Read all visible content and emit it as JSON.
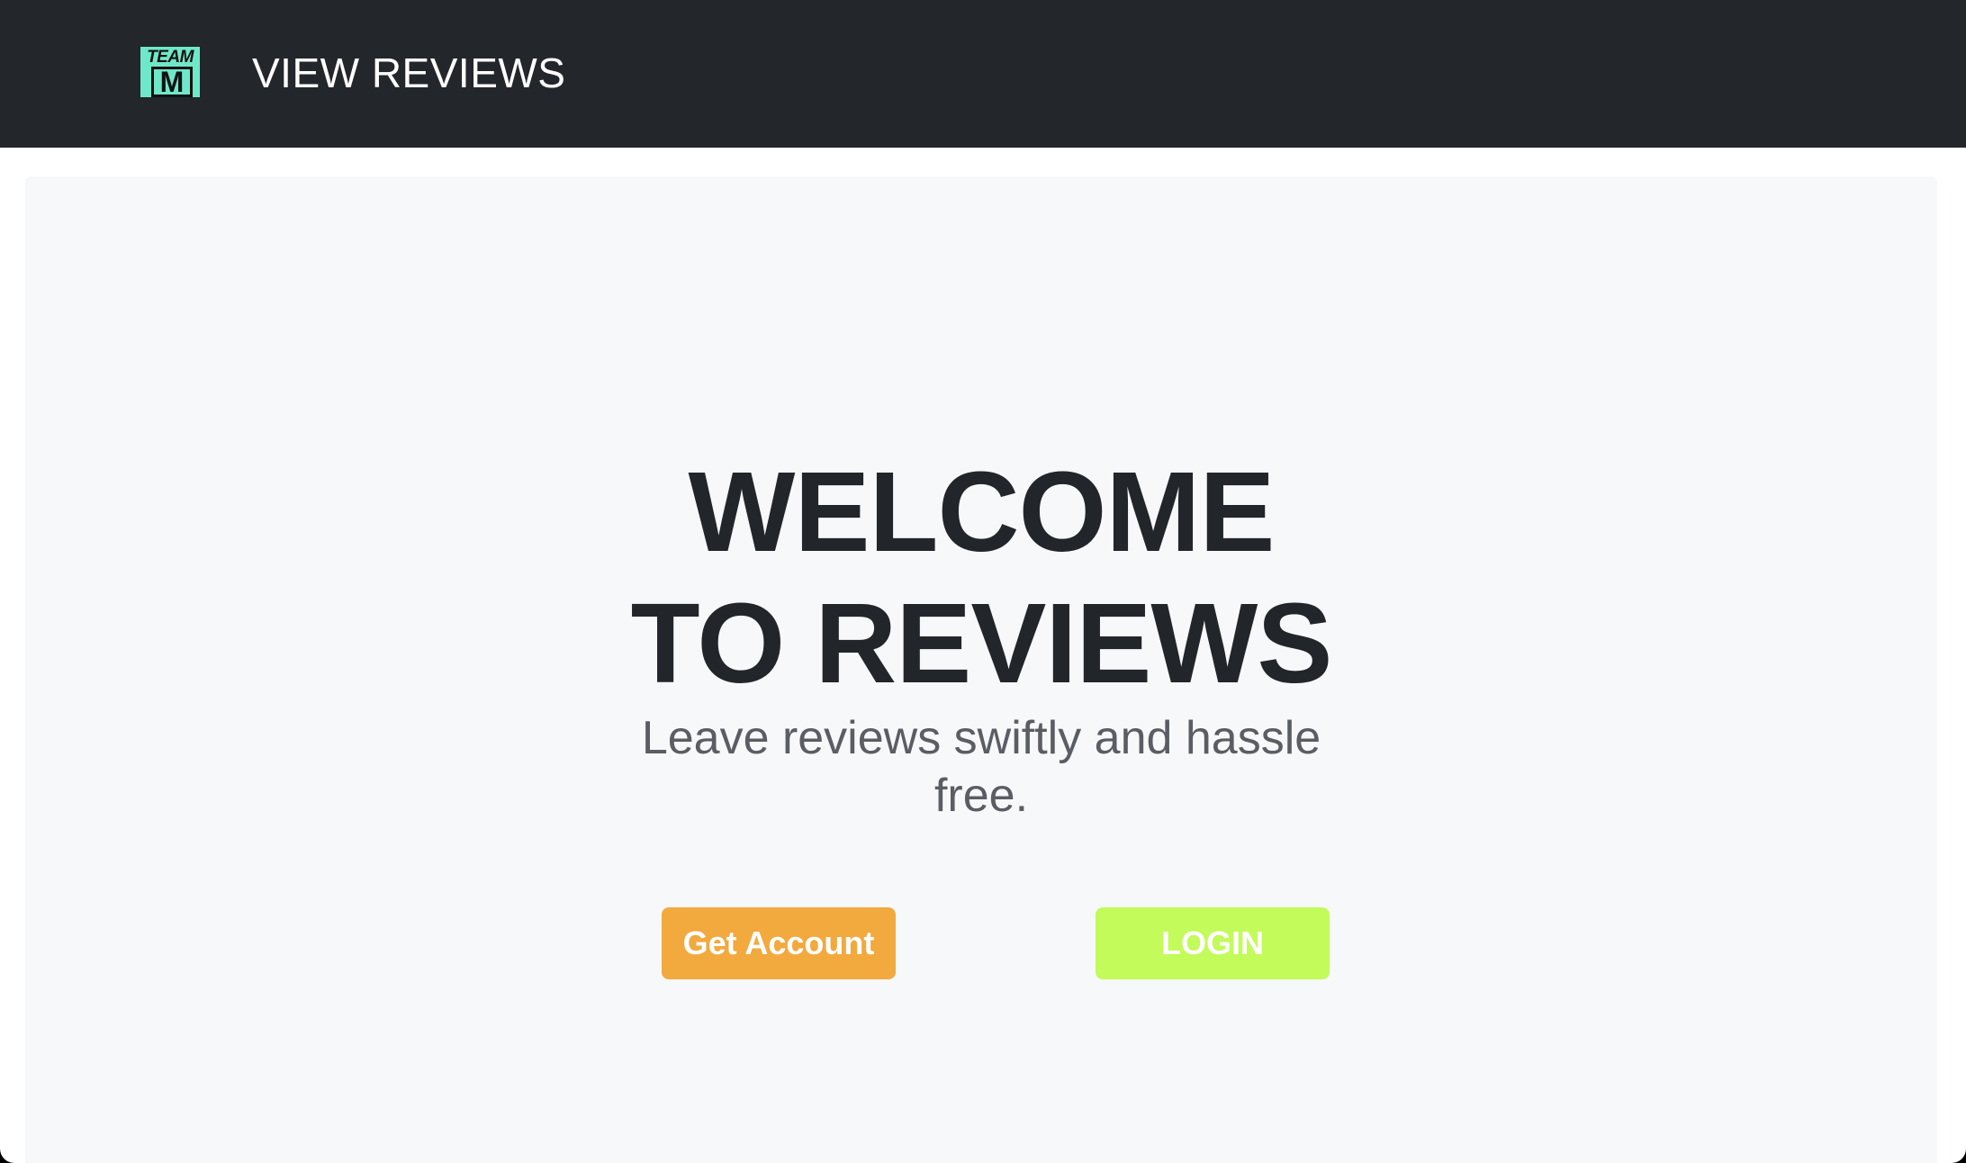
{
  "navbar": {
    "logo_top_text": "TEAM",
    "logo_letter": "M",
    "link_label": "VIEW REVIEWS"
  },
  "hero": {
    "title_line1": "WELCOME",
    "title_line2": "TO REVIEWS",
    "subtitle": "Leave reviews swiftly and hassle free.",
    "get_account_label": "Get Account",
    "login_label": "LOGIN"
  },
  "colors": {
    "navbar_bg": "#23262b",
    "logo_bg": "#6fe8c9",
    "hero_bg": "#f7f8fa",
    "get_account_bg": "#f2a93e",
    "login_bg": "#c2fb5a",
    "title_text": "#22252a"
  }
}
